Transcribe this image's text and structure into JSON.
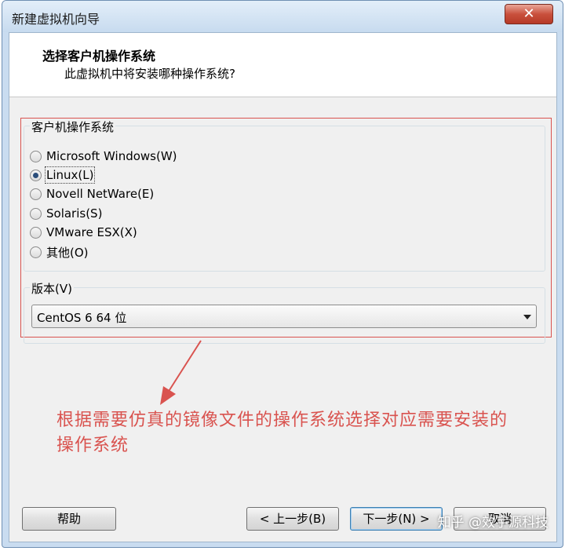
{
  "window": {
    "title": "新建虚拟机向导",
    "close_glyph": "✕"
  },
  "header": {
    "title": "选择客户机操作系统",
    "subtitle": "此虚拟机中将安装哪种操作系统?"
  },
  "os_group": {
    "label": "客户机操作系统",
    "options": [
      {
        "label": "Microsoft Windows(W)",
        "checked": false
      },
      {
        "label": "Linux(L)",
        "checked": true
      },
      {
        "label": "Novell NetWare(E)",
        "checked": false
      },
      {
        "label": "Solaris(S)",
        "checked": false
      },
      {
        "label": "VMware ESX(X)",
        "checked": false
      },
      {
        "label": "其他(O)",
        "checked": false
      }
    ]
  },
  "version_group": {
    "label": "版本(V)",
    "selected": "CentOS 6 64 位"
  },
  "annotation": {
    "text": "根据需要仿真的镜像文件的操作系统选择对应需要安装的操作系统",
    "color": "#d9534f"
  },
  "buttons": {
    "help": "帮助",
    "back": "< 上一步(B)",
    "next": "下一步(N) >",
    "cancel": "取消"
  },
  "watermark": "知乎 @效宇源科技"
}
